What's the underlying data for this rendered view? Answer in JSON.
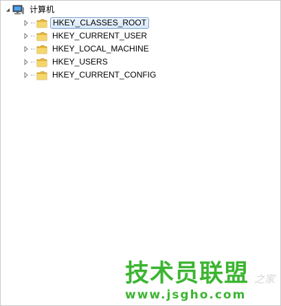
{
  "tree": {
    "root": {
      "label": "计算机",
      "expanded": true,
      "icon": "computer-icon"
    },
    "children": [
      {
        "label": "HKEY_CLASSES_ROOT",
        "selected": true,
        "icon": "folder-icon"
      },
      {
        "label": "HKEY_CURRENT_USER",
        "selected": false,
        "icon": "folder-icon"
      },
      {
        "label": "HKEY_LOCAL_MACHINE",
        "selected": false,
        "icon": "folder-icon"
      },
      {
        "label": "HKEY_USERS",
        "selected": false,
        "icon": "folder-icon"
      },
      {
        "label": "HKEY_CURRENT_CONFIG",
        "selected": false,
        "icon": "folder-icon"
      }
    ]
  },
  "watermark": {
    "title": "技术员联盟",
    "url": "www.jsgho.com",
    "tail": "之家"
  },
  "colors": {
    "selection_border": "#7da2ce",
    "watermark_green": "#3cb532",
    "folder_yellow": "#f2c94c"
  }
}
